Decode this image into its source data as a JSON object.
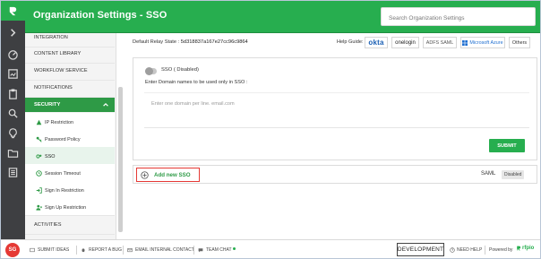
{
  "header": {
    "title": "Organization Settings - SSO",
    "search_placeholder": "Search Organization Settings"
  },
  "sidebar": {
    "items_top": [
      "INTEGRATION",
      "CONTENT LIBRARY",
      "WORKFLOW SERVICE",
      "NOTIFICATIONS"
    ],
    "security_label": "SECURITY",
    "security_subitems": [
      "IP Restriction",
      "Password Policy",
      "SSO",
      "Session Timeout",
      "Sign In Restriction",
      "Sign Up Restriction"
    ],
    "items_bottom": [
      "ACTIVITIES"
    ]
  },
  "main": {
    "relay_label": "Default Relay State :",
    "relay_value": "5d318837a167e27cc96c9864",
    "help_guide_label": "Help Guide:",
    "providers": [
      "okta",
      "onelogin",
      "ADFS SAML",
      "Microsoft Azure",
      "Others"
    ],
    "sso_status": "SSO ( Disabled)",
    "domain_label": "Enter Domain names to be used only in SSO :",
    "domain_placeholder": "Enter one domain per line. email.com",
    "submit_label": "SUBMIT",
    "add_sso_label": "Add new SSO",
    "saml_label": "SAML",
    "saml_badge": "Disabled"
  },
  "footer": {
    "avatar_initials": "SG",
    "links": [
      "SUBMIT IDEAS",
      "REPORT A BUG",
      "EMAIL INTERNAL CONTACT",
      "TEAM CHAT"
    ],
    "environment_label": "DEVELOPMENT",
    "need_help": "NEED HELP",
    "powered_by": "Powered by",
    "brand": "rfpio"
  },
  "colors": {
    "brand_green": "#27ae4f",
    "rail_dark": "#3e3f42",
    "highlight_red": "#e53935"
  }
}
